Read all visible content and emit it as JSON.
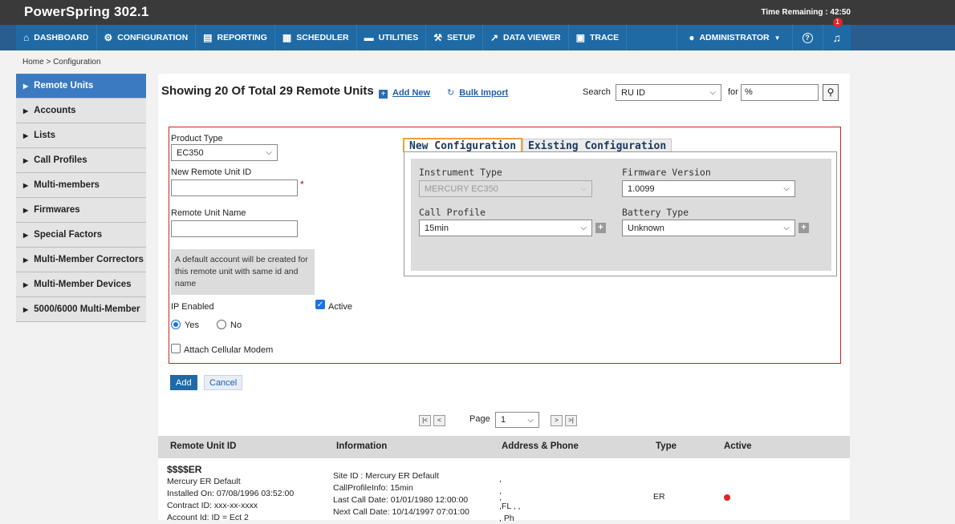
{
  "app": {
    "title": "PowerSpring 302.1",
    "time_remaining": "Time Remaining : 42:50"
  },
  "nav": {
    "items": [
      {
        "label": "DASHBOARD",
        "icon": "home-icon",
        "glyph": "⌂"
      },
      {
        "label": "CONFIGURATION",
        "icon": "gear-icon",
        "glyph": "⚙"
      },
      {
        "label": "REPORTING",
        "icon": "report-icon",
        "glyph": "▤"
      },
      {
        "label": "SCHEDULER",
        "icon": "calendar-icon",
        "glyph": "▦"
      },
      {
        "label": "UTILITIES",
        "icon": "toolbox-icon",
        "glyph": "▬"
      },
      {
        "label": "SETUP",
        "icon": "wrench-icon",
        "glyph": "⚒"
      },
      {
        "label": "DATA VIEWER",
        "icon": "chart-icon",
        "glyph": "↗"
      },
      {
        "label": "TRACE",
        "icon": "trace-icon",
        "glyph": "▣"
      }
    ],
    "user": "ADMINISTRATOR",
    "help_glyph": "?",
    "notification_count": "1"
  },
  "breadcrumb": "Home > Configuration",
  "sidebar": {
    "items": [
      {
        "label": "Remote Units",
        "active": true
      },
      {
        "label": "Accounts"
      },
      {
        "label": "Lists"
      },
      {
        "label": "Call Profiles"
      },
      {
        "label": "Multi-members"
      },
      {
        "label": "Firmwares"
      },
      {
        "label": "Special Factors"
      },
      {
        "label": "Multi-Member Correctors"
      },
      {
        "label": "Multi-Member Devices"
      },
      {
        "label": "5000/6000 Multi-Member"
      }
    ]
  },
  "header": {
    "title": "Showing 20 Of Total 29 Remote Units",
    "add_new": "Add New",
    "bulk_import": "Bulk Import",
    "search_label": "Search",
    "search_field": "RU ID",
    "for_label": "for",
    "search_value": "%"
  },
  "form": {
    "product_type_label": "Product Type",
    "product_type_value": "EC350",
    "new_id_label": "New Remote Unit ID",
    "new_id_value": "",
    "required_mark": "*",
    "name_label": "Remote Unit Name",
    "name_value": "",
    "info_text": "A default account will be created for this remote unit with same id and name",
    "ip_enabled_label": "IP Enabled",
    "active_label": "Active",
    "yes_label": "Yes",
    "no_label": "No",
    "attach_modem_label": "Attach Cellular Modem",
    "add_button": "Add",
    "cancel_button": "Cancel"
  },
  "tabs": {
    "new_config": "New Configuration",
    "existing_config": "Existing Configuration",
    "instrument_type_label": "Instrument Type",
    "instrument_type_value": "MERCURY EC350",
    "firmware_label": "Firmware Version",
    "firmware_value": "1.0099",
    "call_profile_label": "Call Profile",
    "call_profile_value": "15min",
    "battery_label": "Battery Type",
    "battery_value": "Unknown"
  },
  "pager": {
    "first": "|<",
    "prev": "<",
    "page_label": "Page",
    "page_value": "1",
    "next": ">",
    "last": ">|"
  },
  "table": {
    "headers": [
      "Remote Unit ID",
      "Information",
      "Address & Phone",
      "Type",
      "Active"
    ],
    "rows": [
      {
        "id": "$$$$ER",
        "desc": "Mercury ER Default",
        "installed": "Installed On: 07/08/1996 03:52:00",
        "contract": "Contract ID: xxx-xx-xxxx",
        "extra": "Account Id: ID = Ect 2",
        "site": "Site ID : Mercury ER Default",
        "call_profile": "CallProfileInfo: 15min",
        "last_call": "Last Call Date: 01/01/1980 12:00:00",
        "next_call": "Next Call Date: 10/14/1997 07:01:00",
        "addr1": ",",
        "addr2": ",",
        "addr3": ",",
        "addr4": ",FL , ,",
        "addr5": ", Ph",
        "type": "ER"
      }
    ]
  }
}
